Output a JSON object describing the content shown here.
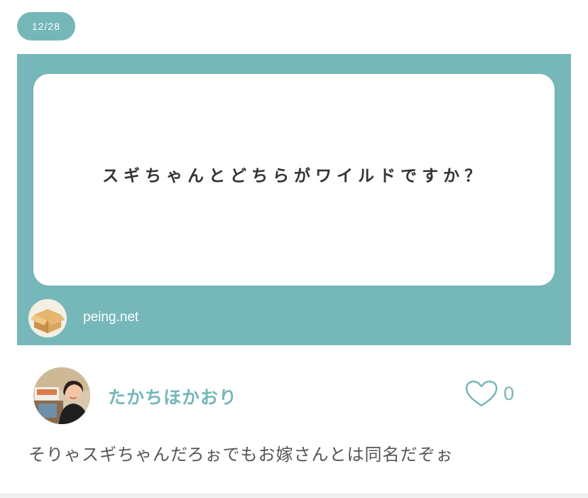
{
  "pagination": {
    "label": "12/28"
  },
  "question_card": {
    "question": "スギちゃんとどちらがワイルドですか？",
    "site": "peing.net",
    "logo_icon": "cardboard-box-icon",
    "background_color": "#76b8ba"
  },
  "answerer": {
    "name": "たかちほかおり",
    "avatar_icon": "user-photo-avatar"
  },
  "likes": {
    "icon": "heart-outline-icon",
    "count": "0"
  },
  "answer": {
    "text": "そりゃスギちゃんだろぉでもお嫁さんとは同名だぞぉ"
  },
  "colors": {
    "accent": "#75b7b9",
    "text": "#555555"
  }
}
